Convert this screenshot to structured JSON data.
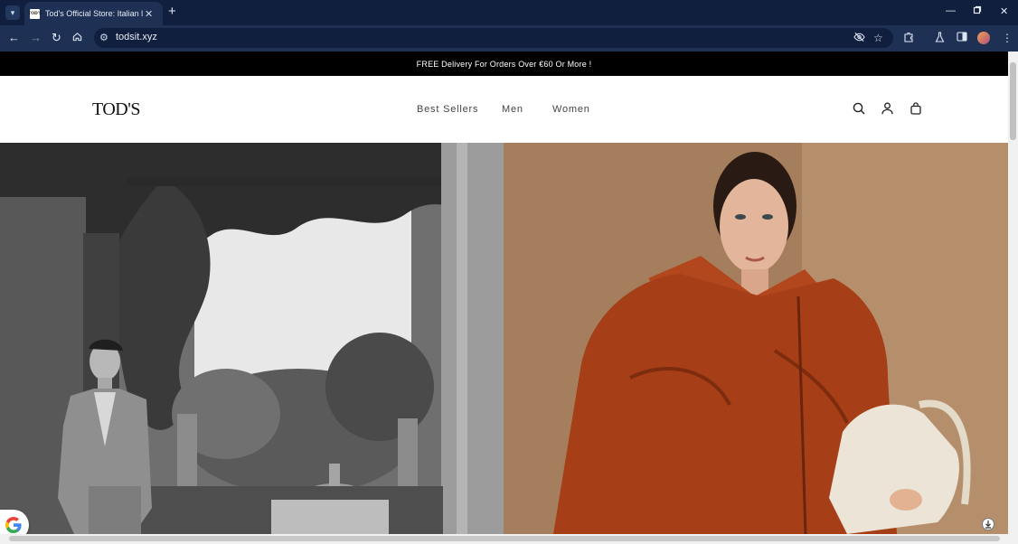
{
  "browser": {
    "tab_title": "Tod's Official Store: Italian luxury",
    "tab_favicon_text": "TOD'S",
    "url": "todsit.xyz",
    "icons": [
      "tab-list-icon",
      "close-icon",
      "plus-icon",
      "minimize-icon",
      "restore-icon",
      "window-close-icon",
      "back-icon",
      "forward-icon",
      "reload-icon",
      "home-icon",
      "site-info-icon",
      "eye-off-icon",
      "star-icon",
      "extensions-icon",
      "labs-icon",
      "sidebar-icon",
      "profile-avatar",
      "menu-dots-icon"
    ]
  },
  "announcement": {
    "text": "FREE Delivery For Orders Over €60 Or More !"
  },
  "header": {
    "logo": "TOD'S",
    "nav": [
      {
        "label": "Best Sellers"
      },
      {
        "label": "Men"
      },
      {
        "label": "Women"
      }
    ],
    "icons": [
      "search-icon",
      "account-icon",
      "bag-icon"
    ]
  },
  "hero": {
    "panels": [
      "men-campaign-image",
      "women-campaign-image"
    ]
  },
  "colors": {
    "chrome_dark": "#0f1f3d",
    "chrome_toolbar": "#1e3154",
    "announcement_bg": "#000000",
    "right_panel_bg": "#a27f5f"
  }
}
